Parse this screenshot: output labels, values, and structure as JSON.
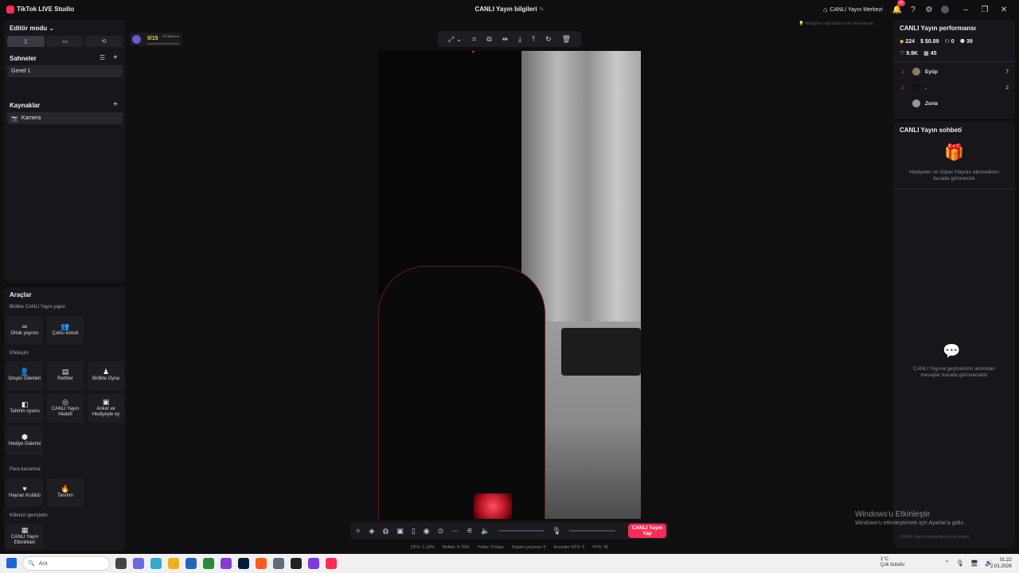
{
  "app": {
    "title": "TikTok LIVE Studio",
    "window_title": "CANLI Yayın bilgileri",
    "live_center": "CANLI Yayın Merkezi",
    "notif_count": "16"
  },
  "left": {
    "editor_mode": "Editör modu",
    "scenes_title": "Sahneler",
    "scene_item": "Genel 1",
    "sources_title": "Kaynaklar",
    "source_item": "Kamera",
    "tools_title": "Araçlar",
    "group1": "Birlikte CANLI Yayın yapın",
    "tools1": [
      "Ortak yayıncı",
      "Çoklu konuk"
    ],
    "group2": "Etkileşim",
    "tools2": [
      "İzleyici Dilekleri",
      "Rehber",
      "Birlikte Oyna",
      "Tahmin oyunu",
      "CANLI Yayın Hedefi",
      "Anket ve Hediyeyle oy",
      "Hediye Galerisi"
    ],
    "group3": "Para kazanma",
    "tools3": [
      "Hayran Kulübü",
      "Tanıtım"
    ],
    "group4": "Kitlenizi genişletin",
    "tools4": [
      "CANLI Yayın Etkinlikleri"
    ]
  },
  "counter": {
    "value": "0/15",
    "time": "07:46:43 m"
  },
  "canvas": {
    "hint": "Widget'e sağ tıklayın ve düzenleyin",
    "go_live": "CANLI Yayın Yap",
    "stats": [
      "CPU: 1.16%",
      "Bellek: 0.76%",
      "Yükle: 0 kbps",
      "Düşen çerçeve: 0",
      "Encoder FPS: 0",
      "FPS: 30"
    ]
  },
  "right": {
    "perf_title": "CANLI Yayın performansı",
    "stats": {
      "coins": "224",
      "money": "$0.89",
      "viewers": "0",
      "follows": "39",
      "likes": "9.9K",
      "gifters": "45"
    },
    "ranking": [
      {
        "rank": "1",
        "name": "Eyüp",
        "score": "7"
      },
      {
        "rank": "2",
        "name": ".",
        "score": "2"
      },
      {
        "rank": "-",
        "name": "Zorla",
        "score": ""
      }
    ],
    "chat_title": "CANLI Yayın sohbeti",
    "gift_msg": "Hediyeler ve Süper Hayran abonelikleri burada görünecek",
    "chat_msg": "CANLI Yayına geçmenizin ardından mesajlar burada görünecektir",
    "input_placeholder": "CANLI Yayın sırasında yorum yapın"
  },
  "windows": {
    "watermark_title": "Windows'u Etkinleştir",
    "watermark_sub": "Windows'u etkinleştirmek için Ayarlar'a gidin."
  },
  "taskbar": {
    "search": "Ara",
    "weather_temp": "1°C",
    "weather_text": "Çok bulutlu",
    "time": "01:22",
    "date": "2.01.2026"
  }
}
